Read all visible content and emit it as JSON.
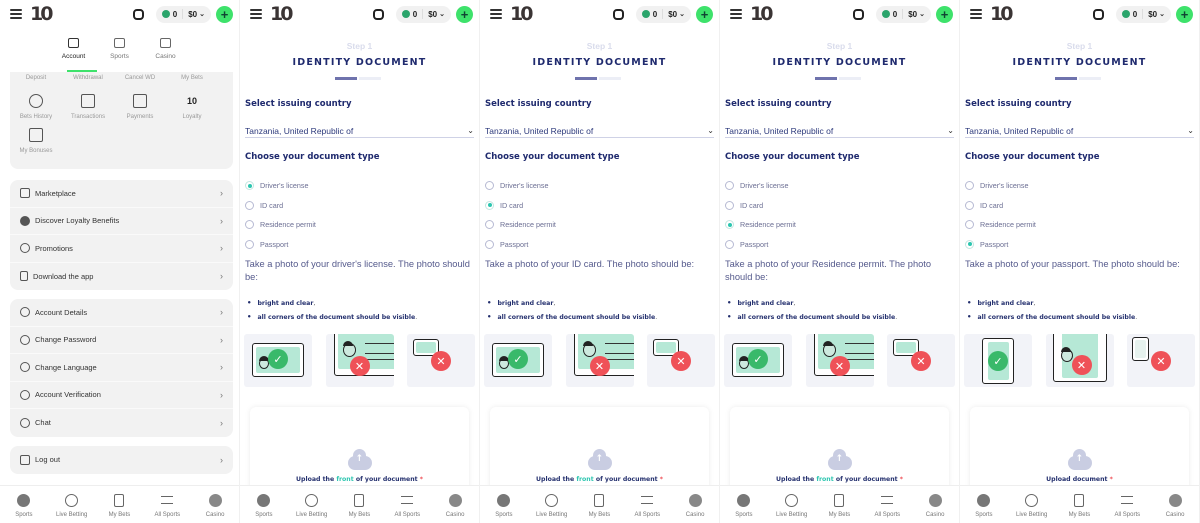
{
  "header": {
    "logo": "10",
    "coins": "0",
    "balance": "$0"
  },
  "account_panel": {
    "tabs": [
      {
        "label": "Account",
        "icon": "wallet-icon",
        "active": true
      },
      {
        "label": "Sports",
        "icon": "scoreboard-icon",
        "active": false
      },
      {
        "label": "Casino",
        "icon": "slot-machine-icon",
        "active": false
      }
    ],
    "quick_top": [
      "Deposit",
      "Withdrawal",
      "Cancel WD",
      "My Bets"
    ],
    "quick_grid": [
      {
        "label": "Bets History",
        "icon": "clock-history-icon"
      },
      {
        "label": "Transactions",
        "icon": "receipt-icon"
      },
      {
        "label": "Payments",
        "icon": "payment-card-icon"
      },
      {
        "label": "Loyalty",
        "icon": "loyalty-logo-icon"
      },
      {
        "label": "My Bonuses",
        "icon": "gift-icon"
      }
    ],
    "menu_group_1": [
      {
        "label": "Marketplace",
        "icon": "store-icon"
      },
      {
        "label": "Discover Loyalty Benefits",
        "icon": "loyalty-coin-icon"
      },
      {
        "label": "Promotions",
        "icon": "promotions-icon"
      },
      {
        "label": "Download the app",
        "icon": "phone-download-icon"
      }
    ],
    "menu_group_2": [
      {
        "label": "Account Details",
        "icon": "user-icon"
      },
      {
        "label": "Change Password",
        "icon": "lock-icon"
      },
      {
        "label": "Change Language",
        "icon": "language-icon"
      },
      {
        "label": "Account Verification",
        "icon": "verification-icon"
      },
      {
        "label": "Chat",
        "icon": "chat-icon"
      }
    ],
    "logout": {
      "label": "Log out",
      "icon": "logout-icon"
    }
  },
  "bottom_nav": [
    {
      "label": "Sports",
      "icon": "trophy-icon"
    },
    {
      "label": "Live Betting",
      "icon": "live-stopwatch-icon"
    },
    {
      "label": "My Bets",
      "icon": "betslip-icon"
    },
    {
      "label": "All Sports",
      "icon": "list-search-icon"
    },
    {
      "label": "Casino",
      "icon": "casino-chip-icon"
    }
  ],
  "identity": {
    "step": "Step 1",
    "title": "IDENTITY DOCUMENT",
    "progress_fraction": 0.5,
    "country_label": "Select issuing country",
    "country_value": "Tanzania, United Republic of",
    "doctype_label": "Choose your document type",
    "doc_types": [
      "Driver's license",
      "ID card",
      "Residence permit",
      "Passport"
    ],
    "bullets": [
      "bright and clear",
      "all corners of the document should be visible"
    ],
    "upload_prefix": "Upload the ",
    "upload_front": "front",
    "upload_suffix": " of your document",
    "upload_document": "Upload document",
    "required_mark": "*"
  },
  "variants": [
    {
      "selected_index": 0,
      "instruction": "Take a photo of your driver's license. The photo should be:",
      "upload_mode": "front",
      "doc_shape": "card"
    },
    {
      "selected_index": 1,
      "instruction": "Take a photo of your ID card. The photo should be:",
      "upload_mode": "front",
      "doc_shape": "card"
    },
    {
      "selected_index": 2,
      "instruction": "Take a photo of your Residence permit. The photo should be:",
      "upload_mode": "front",
      "doc_shape": "card"
    },
    {
      "selected_index": 3,
      "instruction": "Take a photo of your passport. The photo should be:",
      "upload_mode": "document",
      "doc_shape": "passport"
    }
  ],
  "colors": {
    "accent_green": "#3ee26b",
    "brand_navy": "#1f2a6e",
    "radio_teal": "#2dc6b0",
    "ok_green": "#39b96a",
    "error_red": "#ef5158"
  }
}
